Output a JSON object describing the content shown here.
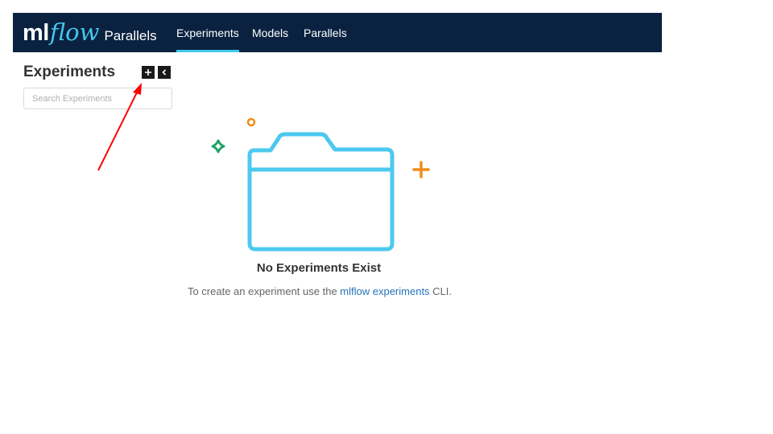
{
  "navbar": {
    "logo_ml": "ml",
    "logo_flow": "flow",
    "logo_product": "Parallels",
    "links": [
      {
        "label": "Experiments",
        "active": true
      },
      {
        "label": "Models",
        "active": false
      },
      {
        "label": "Parallels",
        "active": false
      }
    ],
    "bg_color": "#0a2240",
    "accent_color": "#43c9ed"
  },
  "sidebar": {
    "title": "Experiments",
    "add_icon": "plus-icon",
    "collapse_icon": "chevron-left-icon",
    "search_placeholder": "Search Experiments"
  },
  "empty_state": {
    "title": "No Experiments Exist",
    "description_prefix": "To create an experiment use the ",
    "link_text": "mlflow experiments",
    "description_suffix": " CLI.",
    "folder_color": "#4cc9ef",
    "icons": [
      "folder-icon",
      "orange-circle-icon",
      "green-star-icon",
      "orange-plus-icon"
    ]
  },
  "annotation": {
    "arrow_color": "#ff0000",
    "icon": "red-arrow-icon"
  }
}
